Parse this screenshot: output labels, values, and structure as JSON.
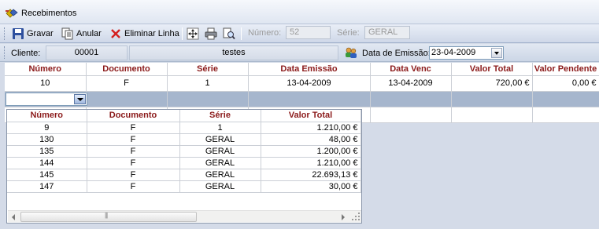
{
  "window": {
    "title": "Recebimentos"
  },
  "toolbar": {
    "save_label": "Gravar",
    "cancel_label": "Anular",
    "delete_line_label": "Eliminar Linha",
    "number_label": "Número:",
    "number_value": "52",
    "series_label": "Série:",
    "series_value": "GERAL"
  },
  "client": {
    "label": "Cliente:",
    "code": "00001",
    "name": "testes",
    "date_label": "Data de Emissão:",
    "date_value": "23-04-2009"
  },
  "grid": {
    "columns": [
      "Número",
      "Documento",
      "Série",
      "Data Emissão",
      "Data Venc",
      "Valor Total",
      "Valor Pendente"
    ],
    "rows": [
      {
        "numero": "10",
        "documento": "F",
        "serie": "1",
        "data_emissao": "13-04-2009",
        "data_venc": "13-04-2009",
        "valor_total": "720,00 €",
        "valor_pendente": "0,00 €"
      }
    ]
  },
  "dropdown": {
    "columns": [
      "Número",
      "Documento",
      "Série",
      "Valor Total"
    ],
    "rows": [
      {
        "numero": "9",
        "documento": "F",
        "serie": "1",
        "valor_total": "1.210,00 €"
      },
      {
        "numero": "130",
        "documento": "F",
        "serie": "GERAL",
        "valor_total": "48,00 €"
      },
      {
        "numero": "135",
        "documento": "F",
        "serie": "GERAL",
        "valor_total": "1.200,00 €"
      },
      {
        "numero": "144",
        "documento": "F",
        "serie": "GERAL",
        "valor_total": "1.210,00 €"
      },
      {
        "numero": "145",
        "documento": "F",
        "serie": "GERAL",
        "valor_total": "22.693,13 €"
      },
      {
        "numero": "147",
        "documento": "F",
        "serie": "GERAL",
        "valor_total": "30,00 €"
      }
    ]
  }
}
